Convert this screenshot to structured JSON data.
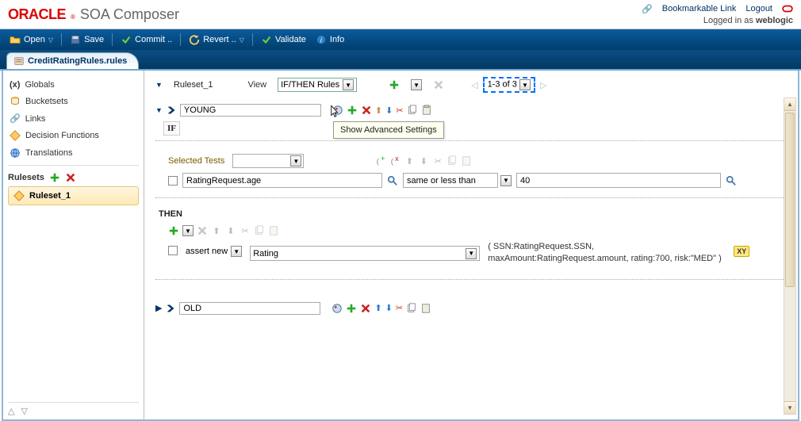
{
  "brand": {
    "oracle": "ORACLE",
    "reg": "®",
    "app": "SOA Composer"
  },
  "header": {
    "bookmark": "Bookmarkable Link",
    "logout": "Logout",
    "login_prefix": "Logged in as ",
    "login_user": "weblogic"
  },
  "toolbar": {
    "open": "Open",
    "save": "Save",
    "commit": "Commit ..",
    "revert": "Revert ..",
    "validate": "Validate",
    "info": "Info"
  },
  "tab": {
    "label": "CreditRatingRules.rules"
  },
  "sidebar": {
    "globals": "Globals",
    "bucketsets": "Bucketsets",
    "links": "Links",
    "decision_fns": "Decision Functions",
    "translations": "Translations",
    "rulesets_heading": "Rulesets",
    "ruleset1": "Ruleset_1"
  },
  "main": {
    "ruleset_label": "Ruleset_1",
    "view_label": "View",
    "view_value": "IF/THEN Rules",
    "pager_text": "1-3 of 3",
    "rule_name": "YOUNG",
    "tooltip": "Show Advanced Settings",
    "if_label": "IF",
    "selected_tests": "Selected Tests",
    "cond_field": "RatingRequest.age",
    "cond_op": "same or less than",
    "cond_val": "40",
    "then_label": "THEN",
    "assert_label": "assert new",
    "rating_label": "Rating",
    "rating_readout": "( SSN:RatingRequest.SSN, maxAmount:RatingRequest.amount, rating:700, risk:\"MED\" )",
    "xy": "XY",
    "old_label": "OLD"
  }
}
